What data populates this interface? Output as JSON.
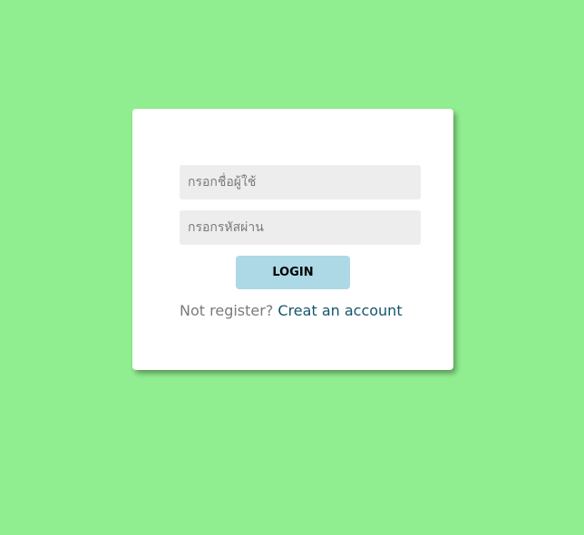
{
  "colors": {
    "background": "#90ee90",
    "card": "#ffffff",
    "input_background": "#ededed",
    "button": "#add8e6",
    "link": "#14566b",
    "muted_text": "#7a7a7a"
  },
  "login_form": {
    "username": {
      "value": "",
      "placeholder": "กรอกชื่อผู้ใช้"
    },
    "password": {
      "value": "",
      "placeholder": "กรอกรหัสผ่าน"
    },
    "login_button_label": "LOGIN",
    "register_prompt": "Not register?",
    "create_account_link": "Creat an account"
  }
}
